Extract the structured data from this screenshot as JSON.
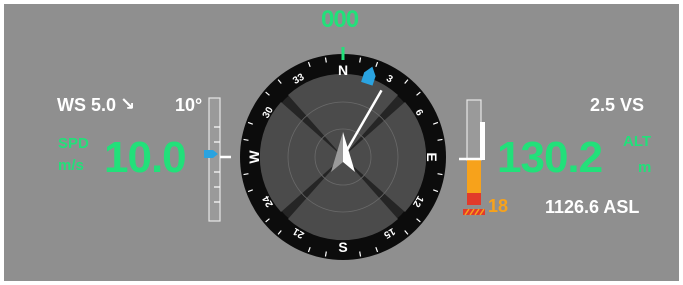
{
  "heading": {
    "readout": "000",
    "value": 0
  },
  "wind": {
    "label": "WS 5.0",
    "arrow": "↘"
  },
  "pitch": {
    "label": "10°"
  },
  "vertical_speed": {
    "label": "2.5 VS"
  },
  "speed": {
    "label_top": "SPD",
    "label_unit": "m/s",
    "value": "10.0"
  },
  "altitude": {
    "label_top": "ALT",
    "label_unit": "m",
    "value": "130.2",
    "asl": "1126.6 ASL",
    "ground_warning": "18"
  },
  "compass": {
    "cardinals": {
      "north": "N",
      "east": "E",
      "south": "S",
      "west": "W"
    },
    "ticks": {
      "t3": "3",
      "t6": "6",
      "t12": "12",
      "t15": "15",
      "t21": "21",
      "t24": "24",
      "t30": "30",
      "t33": "33"
    },
    "needle_heading_deg": 30,
    "home_marker_heading_deg": 18
  },
  "colors": {
    "background": "#8f8f8f",
    "primary_green": "#22e07a",
    "warning_orange": "#f7a21b",
    "danger_red": "#e23a2a",
    "marker_blue": "#2aa3e0"
  }
}
